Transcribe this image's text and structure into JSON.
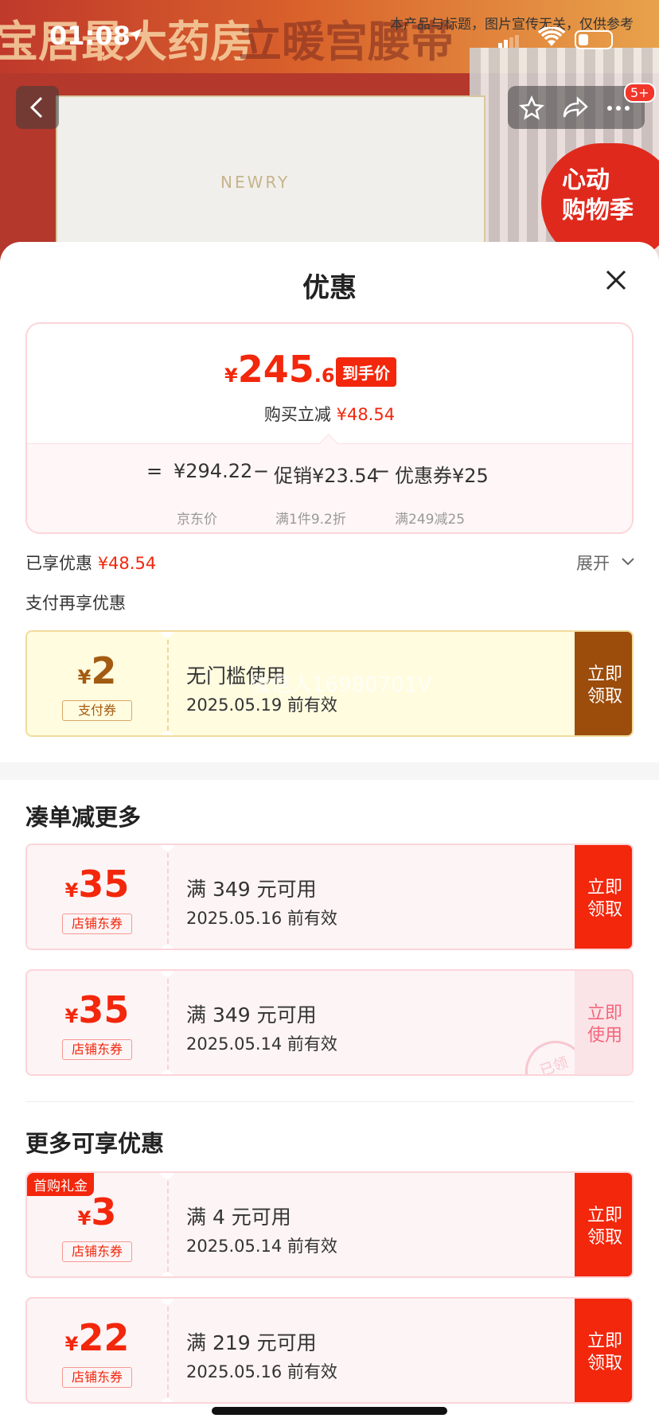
{
  "background": {
    "banner_left_text": "宝居最大药房",
    "banner_right_text": "立暖宫腰带",
    "box_logo": "NEWRY",
    "sale_badge": "心动\n购物季",
    "disclaimer": "本产品与标题，图片宣传无关，仅供参考"
  },
  "status_bar": {
    "time": "01:08"
  },
  "nav": {
    "badge": "5+"
  },
  "sheet": {
    "title": "优惠"
  },
  "price_card": {
    "yen": "¥",
    "price_int": "245",
    "price_dec": ".68",
    "price_tag": "到手价",
    "save_label": "购买立减",
    "save_amount": "¥48.54",
    "formula": {
      "eq": "=",
      "jd_price": "¥294.22",
      "jd_label": "京东价",
      "minus1": "−",
      "promo": "促销¥23.54",
      "promo_label": "满1件9.2折",
      "minus2": "−",
      "coupon": "优惠券¥25",
      "coupon_label": "满249减25"
    }
  },
  "enjoyed": {
    "label": "已享优惠",
    "amount": "¥48.54",
    "expand": "展开"
  },
  "pay_more_label": "支付再享优惠",
  "pay_coupon": {
    "yen": "¥",
    "amount": "2",
    "type": "支付券",
    "condition": "无门槛使用",
    "expiry": "2025.05.19 前有效",
    "button": "立即\n领取",
    "watermark": "微信人16980701V"
  },
  "sections": {
    "more_order": "凑单减更多",
    "more_offers": "更多可享优惠"
  },
  "shop_coupons_a": [
    {
      "yen": "¥",
      "amount": "35",
      "type": "店铺东券",
      "condition": "满 349 元可用",
      "expiry": "2025.05.16 前有效",
      "button": "立即\n领取",
      "used": false
    },
    {
      "yen": "¥",
      "amount": "35",
      "type": "店铺东券",
      "condition": "满 349 元可用",
      "expiry": "2025.05.14 前有效",
      "button": "立即\n使用",
      "used": true,
      "stamp": "已领"
    }
  ],
  "shop_coupons_b": [
    {
      "yen": "¥",
      "amount": "3",
      "type": "店铺东券",
      "tag": "首购礼金",
      "condition": "满 4 元可用",
      "expiry": "2025.05.14 前有效",
      "button": "立即\n领取"
    },
    {
      "yen": "¥",
      "amount": "22",
      "type": "店铺东券",
      "condition": "满 219 元可用",
      "expiry": "2025.05.16 前有效",
      "button": "立即\n领取"
    }
  ],
  "colors": {
    "accent_red": "#f2270c",
    "pay_brown": "#9c4c0b"
  },
  "icons": [
    "location-arrow-icon",
    "signal-icon",
    "wifi-icon",
    "battery-icon",
    "back-chevron-icon",
    "star-icon",
    "share-icon",
    "more-icon",
    "close-icon",
    "chevron-down-icon"
  ]
}
